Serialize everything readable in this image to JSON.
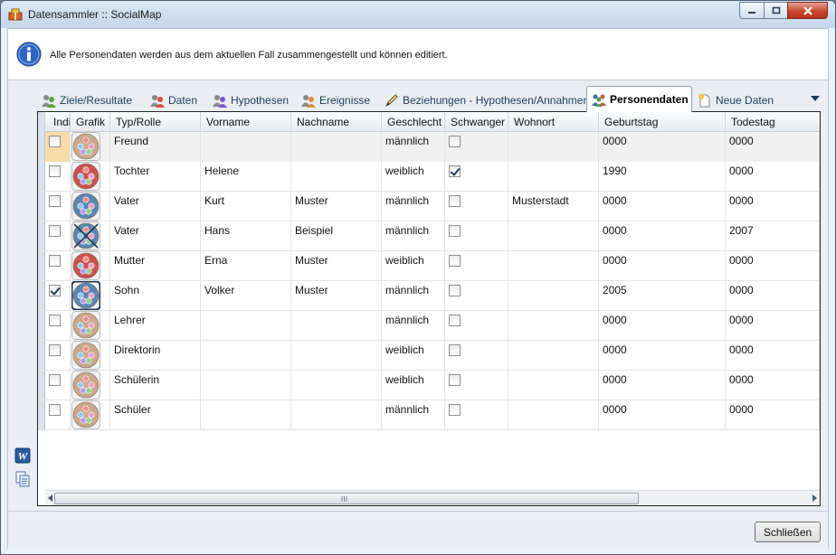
{
  "window": {
    "title": "Datensammler :: SocialMap"
  },
  "info": {
    "text": "Alle Personendaten werden aus dem aktuellen Fall zusammengestellt und können editiert."
  },
  "tabs": [
    {
      "label": "Ziele/Resultate",
      "icon": "two-person-green-icon"
    },
    {
      "label": "Daten",
      "icon": "two-person-red-icon"
    },
    {
      "label": "Hypothesen",
      "icon": "two-person-purple-icon"
    },
    {
      "label": "Ereignisse",
      "icon": "two-person-orange-icon"
    },
    {
      "label": "Beziehungen - Hypothesen/Annahmen",
      "icon": "pencil-icon"
    },
    {
      "label": "Personendaten",
      "icon": "people-group-icon",
      "active": true
    },
    {
      "label": "Neue Daten",
      "icon": "new-document-icon"
    }
  ],
  "grid": {
    "columns": [
      "Indi",
      "Grafik",
      "Typ/Rolle",
      "Vorname",
      "Nachname",
      "Geschlecht",
      "Schwanger",
      "Wohnort",
      "Geburtstag",
      "Todestag"
    ],
    "rows": [
      {
        "ind": false,
        "style": "light-brown",
        "role": "Freund",
        "first": "",
        "last": "",
        "gender": "männlich",
        "pregnant": false,
        "place": "",
        "birth": "0000",
        "death": "0000"
      },
      {
        "ind": false,
        "style": "red",
        "role": "Tochter",
        "first": "Helene",
        "last": "",
        "gender": "weiblich",
        "pregnant": true,
        "place": "",
        "birth": "1990",
        "death": "0000"
      },
      {
        "ind": false,
        "style": "blue",
        "role": "Vater",
        "first": "Kurt",
        "last": "Muster",
        "gender": "männlich",
        "pregnant": false,
        "place": "Musterstadt",
        "birth": "0000",
        "death": "0000"
      },
      {
        "ind": false,
        "style": "blue-crossed",
        "role": "Vater",
        "first": "Hans",
        "last": "Beispiel",
        "gender": "männlich",
        "pregnant": false,
        "place": "",
        "birth": "0000",
        "death": "2007"
      },
      {
        "ind": false,
        "style": "red",
        "role": "Mutter",
        "first": "Erna",
        "last": "Muster",
        "gender": "weiblich",
        "pregnant": false,
        "place": "",
        "birth": "0000",
        "death": "0000"
      },
      {
        "ind": true,
        "style": "blue-selected",
        "role": "Sohn",
        "first": "Volker",
        "last": "Muster",
        "gender": "männlich",
        "pregnant": false,
        "place": "",
        "birth": "2005",
        "death": "0000"
      },
      {
        "ind": false,
        "style": "light-brown",
        "role": "Lehrer",
        "first": "",
        "last": "",
        "gender": "männlich",
        "pregnant": false,
        "place": "",
        "birth": "0000",
        "death": "0000"
      },
      {
        "ind": false,
        "style": "light-brown",
        "role": "Direktorin",
        "first": "",
        "last": "",
        "gender": "weiblich",
        "pregnant": false,
        "place": "",
        "birth": "0000",
        "death": "0000"
      },
      {
        "ind": false,
        "style": "light-brown",
        "role": "Schülerin",
        "first": "",
        "last": "",
        "gender": "weiblich",
        "pregnant": false,
        "place": "",
        "birth": "0000",
        "death": "0000"
      },
      {
        "ind": false,
        "style": "light-brown",
        "role": "Schüler",
        "first": "",
        "last": "",
        "gender": "männlich",
        "pregnant": false,
        "place": "",
        "birth": "0000",
        "death": "0000"
      }
    ]
  },
  "side_buttons": [
    {
      "icon": "word-export-icon"
    },
    {
      "icon": "copy-document-icon"
    }
  ],
  "footer": {
    "close_label": "Schließen"
  },
  "colors": {
    "graphic_light_brown": "#c9a88b",
    "graphic_red": "#c8524f",
    "graphic_blue": "#5b86b0",
    "selected_row": "#f7dca8"
  }
}
